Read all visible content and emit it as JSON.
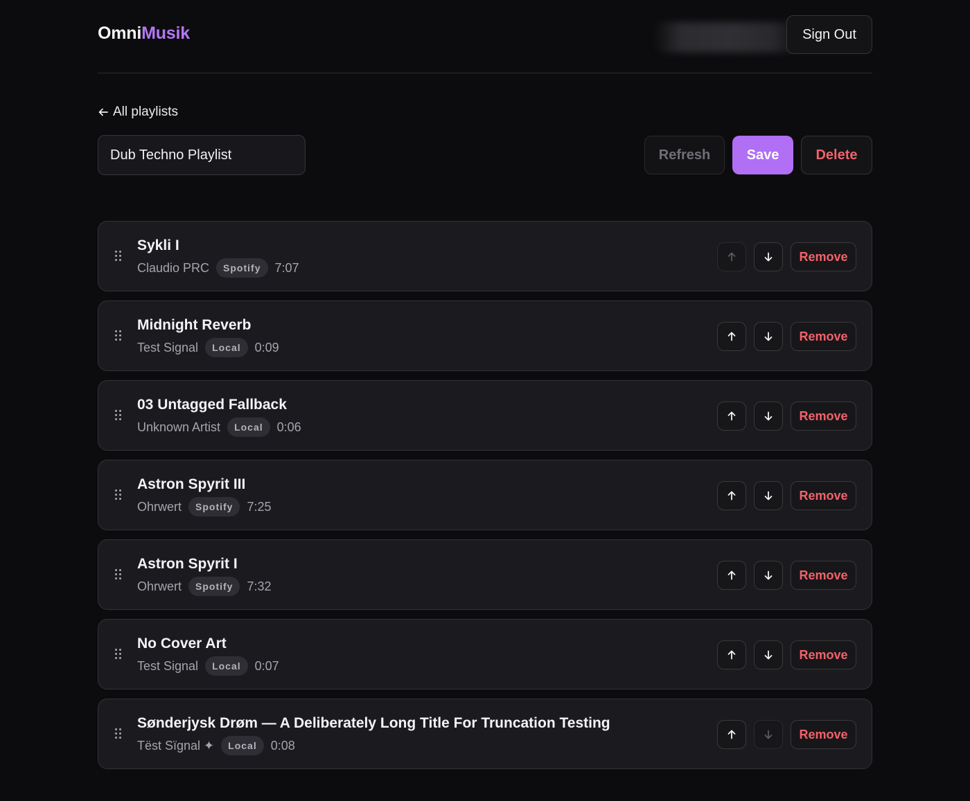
{
  "app": {
    "logo_part1": "Omni",
    "logo_part2": "Musik",
    "brand_color": "#b477f5"
  },
  "header": {
    "sign_out_label": "Sign Out"
  },
  "nav": {
    "back_label": "All playlists"
  },
  "playlist": {
    "name": "Dub Techno Playlist"
  },
  "actions": {
    "refresh_label": "Refresh",
    "save_label": "Save",
    "delete_label": "Delete"
  },
  "colors": {
    "accent": "#b06ff5",
    "danger": "#f3626a",
    "background": "#0c0c0e",
    "card": "#1b1b1f"
  },
  "tracks": [
    {
      "title": "Sykli I",
      "artist": "Claudio PRC",
      "source": "Spotify",
      "duration": "7:07",
      "up_disabled": true,
      "down_disabled": false,
      "remove_label": "Remove"
    },
    {
      "title": "Midnight Reverb",
      "artist": "Test Signal",
      "source": "Local",
      "duration": "0:09",
      "up_disabled": false,
      "down_disabled": false,
      "remove_label": "Remove"
    },
    {
      "title": "03 Untagged Fallback",
      "artist": "Unknown Artist",
      "source": "Local",
      "duration": "0:06",
      "up_disabled": false,
      "down_disabled": false,
      "remove_label": "Remove"
    },
    {
      "title": "Astron Spyrit III",
      "artist": "Ohrwert",
      "source": "Spotify",
      "duration": "7:25",
      "up_disabled": false,
      "down_disabled": false,
      "remove_label": "Remove"
    },
    {
      "title": "Astron Spyrit I",
      "artist": "Ohrwert",
      "source": "Spotify",
      "duration": "7:32",
      "up_disabled": false,
      "down_disabled": false,
      "remove_label": "Remove"
    },
    {
      "title": "No Cover Art",
      "artist": "Test Signal",
      "source": "Local",
      "duration": "0:07",
      "up_disabled": false,
      "down_disabled": false,
      "remove_label": "Remove"
    },
    {
      "title": "Sønderjysk Drøm — A Deliberately Long Title For Truncation Testing",
      "artist": "Tëst Sïgnal ✦",
      "source": "Local",
      "duration": "0:08",
      "up_disabled": false,
      "down_disabled": true,
      "remove_label": "Remove"
    }
  ]
}
